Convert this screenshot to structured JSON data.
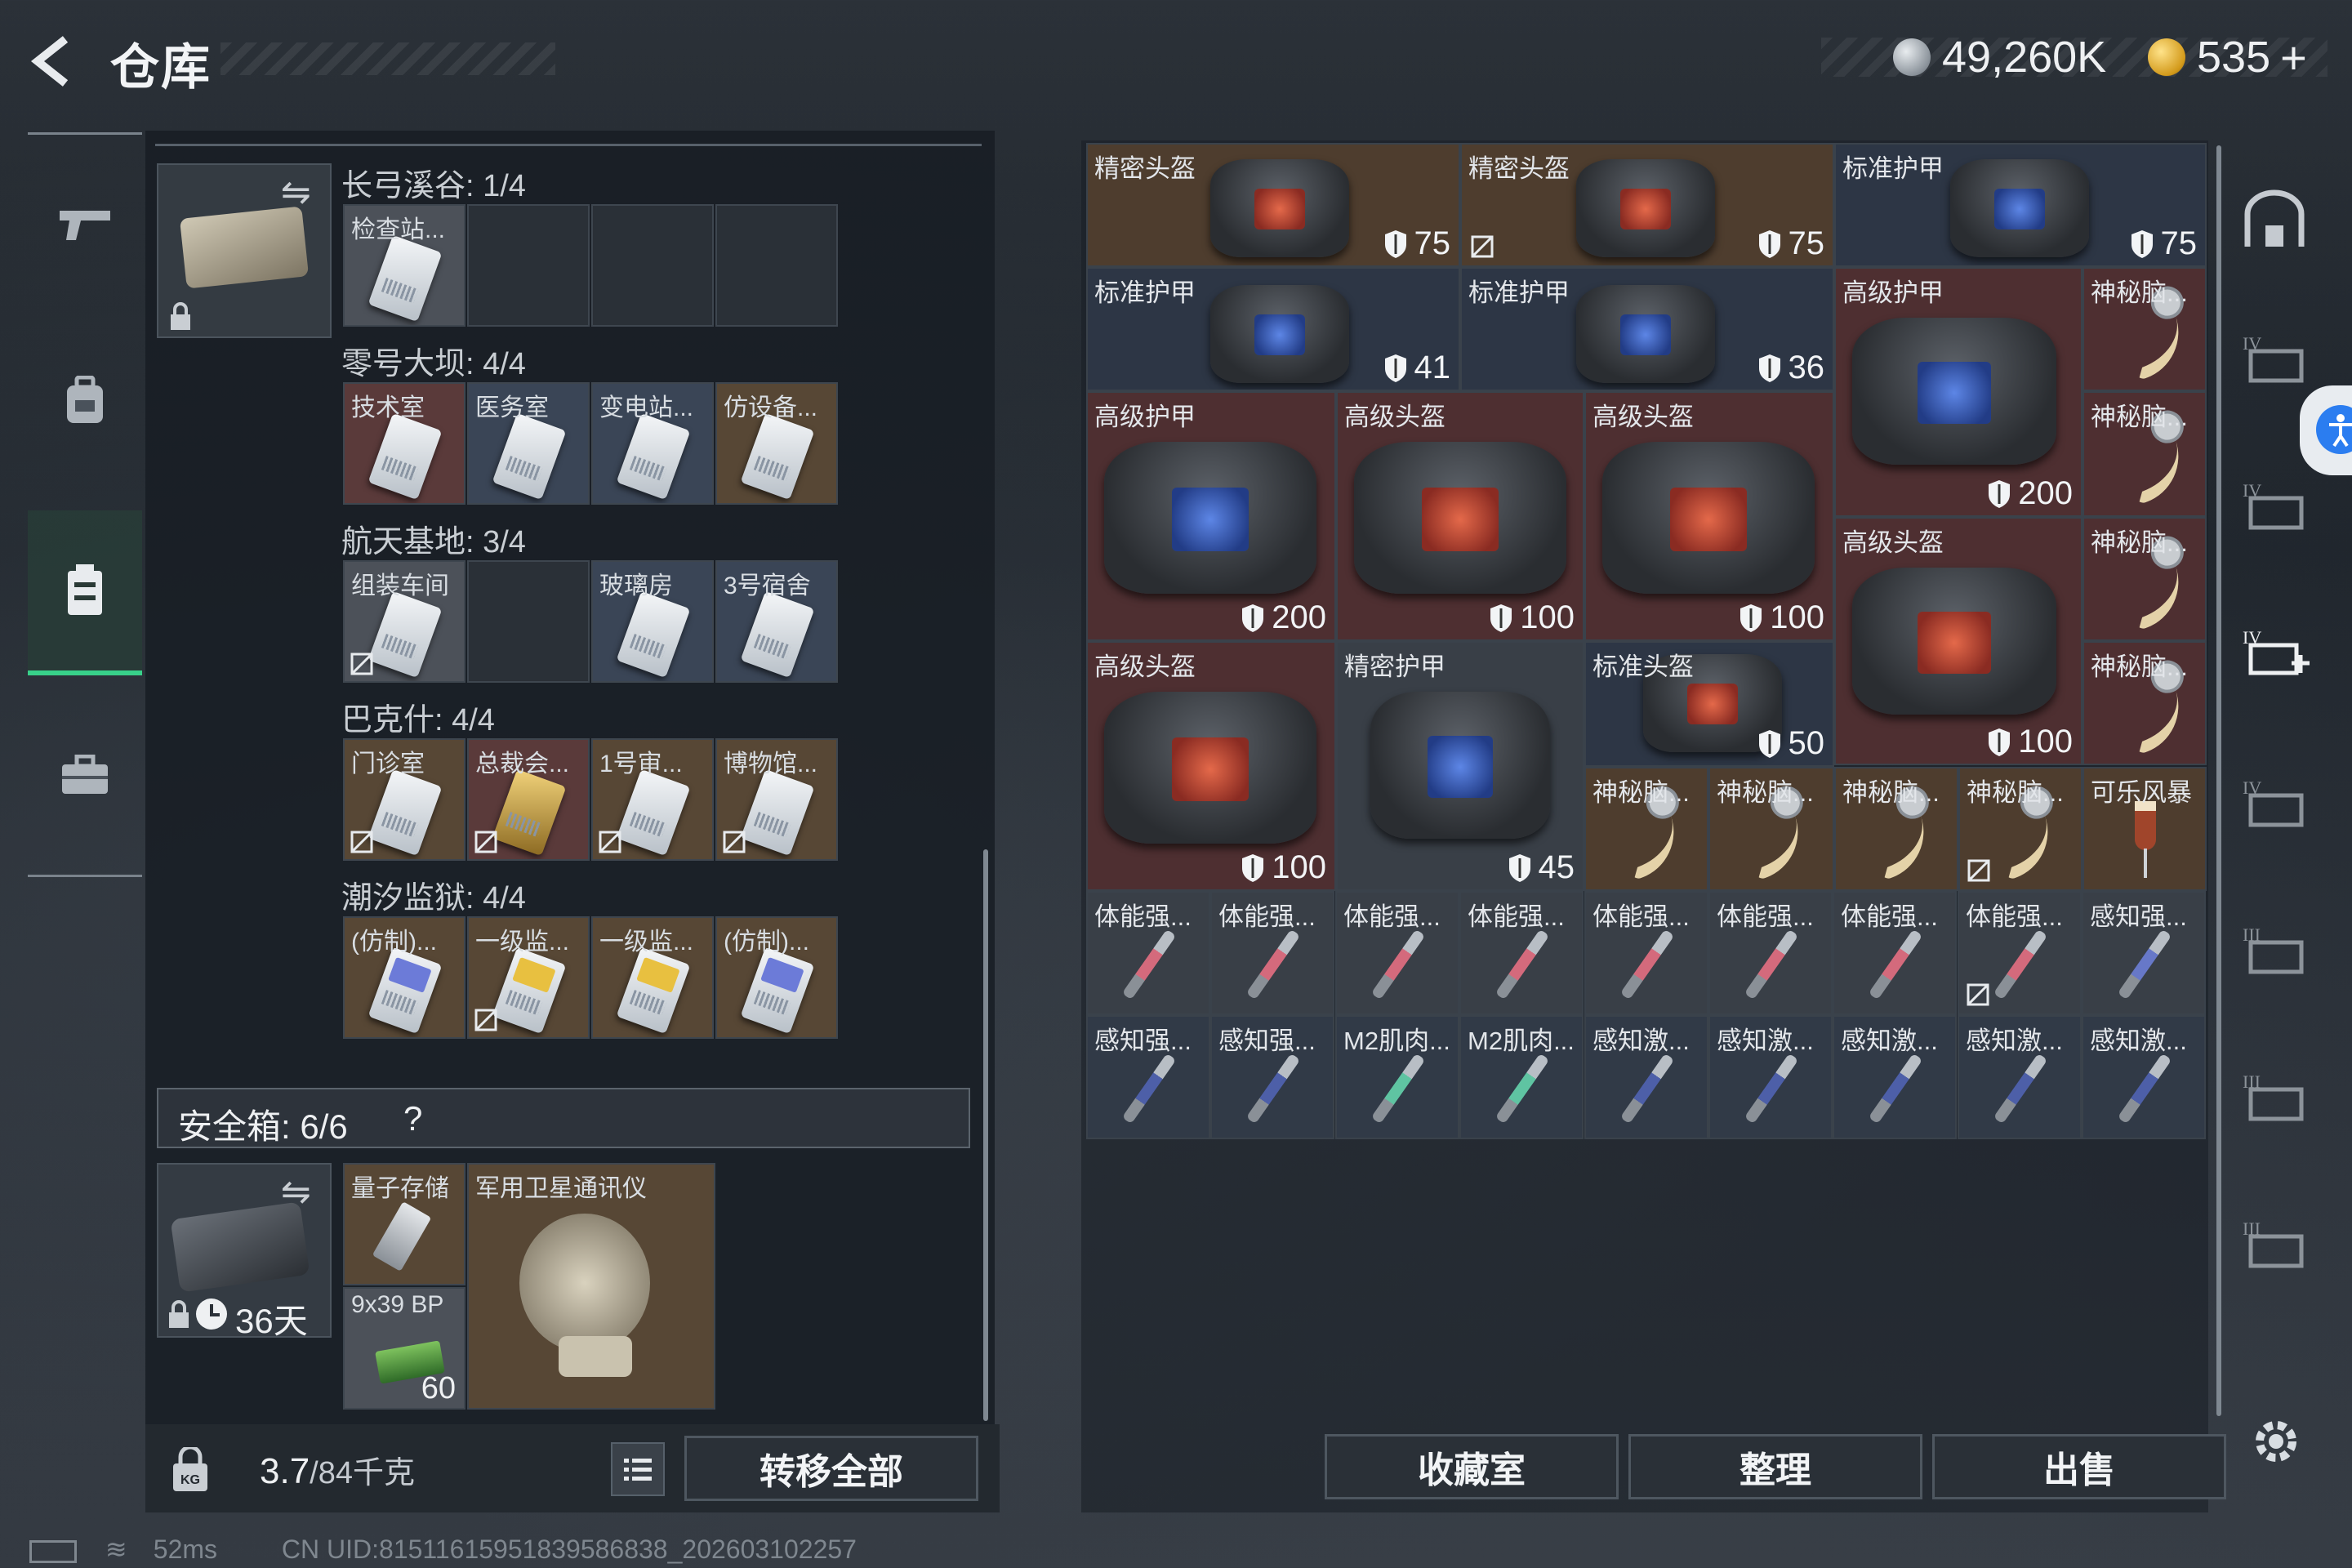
{
  "header": {
    "title": "仓库"
  },
  "currency": {
    "silver": "49,260K",
    "gold": "535",
    "gold_plus": "+"
  },
  "left": {
    "sections": [
      {
        "title": "长弓溪谷: 1/4",
        "slots": [
          "检查站...",
          "",
          "",
          ""
        ]
      },
      {
        "title": "零号大坝: 4/4",
        "slots": [
          "技术室",
          "医务室",
          "变电站...",
          "仿设备..."
        ]
      },
      {
        "title": "航天基地: 3/4",
        "slots": [
          "组装车间",
          "",
          "玻璃房",
          "3号宿舍"
        ]
      },
      {
        "title": "巴克什: 4/4",
        "slots": [
          "门诊室",
          "总裁会...",
          "1号审...",
          "博物馆..."
        ]
      },
      {
        "title": "潮汐监狱: 4/4",
        "slots": [
          "(仿制)...",
          "一级监...",
          "一级监...",
          "(仿制)..."
        ]
      }
    ],
    "safe_label": "安全箱:  6/6",
    "safe_help": "?",
    "safe_timer": "36天",
    "safe_items": {
      "quantum": "量子存储",
      "satellite": "军用卫星通讯仪",
      "ammo_name": "9x39 BP",
      "ammo_count": "60"
    },
    "weight": "3.7",
    "weight_max": "/84千克",
    "transfer_all": "转移全部"
  },
  "grid": {
    "row1": [
      {
        "label": "精密头盔",
        "val": "75"
      },
      {
        "label": "精密头盔",
        "val": "75"
      },
      {
        "label": "标准护甲",
        "val": "75"
      }
    ],
    "row2": [
      {
        "label": "标准护甲",
        "val": "41"
      },
      {
        "label": "标准护甲",
        "val": "36"
      }
    ],
    "big1": [
      {
        "label": "高级护甲",
        "val": "200"
      },
      {
        "label": "高级头盔",
        "val": "100"
      },
      {
        "label": "高级头盔",
        "val": "100"
      }
    ],
    "right_big": [
      {
        "label": "高级护甲",
        "val": "200"
      },
      {
        "label": "高级头盔",
        "val": "100"
      }
    ],
    "horns": [
      "神秘脑...",
      "神秘脑...",
      "神秘脑...",
      "神秘脑..."
    ],
    "big2": [
      {
        "label": "高级头盔",
        "val": "100"
      },
      {
        "label": "精密护甲",
        "val": "45"
      }
    ],
    "std_helmet": {
      "label": "标准头盔",
      "val": "50"
    },
    "row7": [
      "神秘脑...",
      "神秘脑...",
      "神秘脑...",
      "神秘脑...",
      "可乐风暴"
    ],
    "row8": [
      "体能强...",
      "体能强...",
      "体能强...",
      "体能强...",
      "体能强...",
      "体能强...",
      "体能强...",
      "体能强...",
      "感知强..."
    ],
    "row9": [
      "感知强...",
      "感知强...",
      "M2肌肉...",
      "M2肌肉...",
      "感知激...",
      "感知激...",
      "感知激...",
      "感知激...",
      "感知激..."
    ]
  },
  "buttons": {
    "collection": "收藏室",
    "organize": "整理",
    "sell": "出售"
  },
  "status": {
    "ping": "52ms",
    "uid": "CN UID:81511615951839586838_202603102257"
  }
}
